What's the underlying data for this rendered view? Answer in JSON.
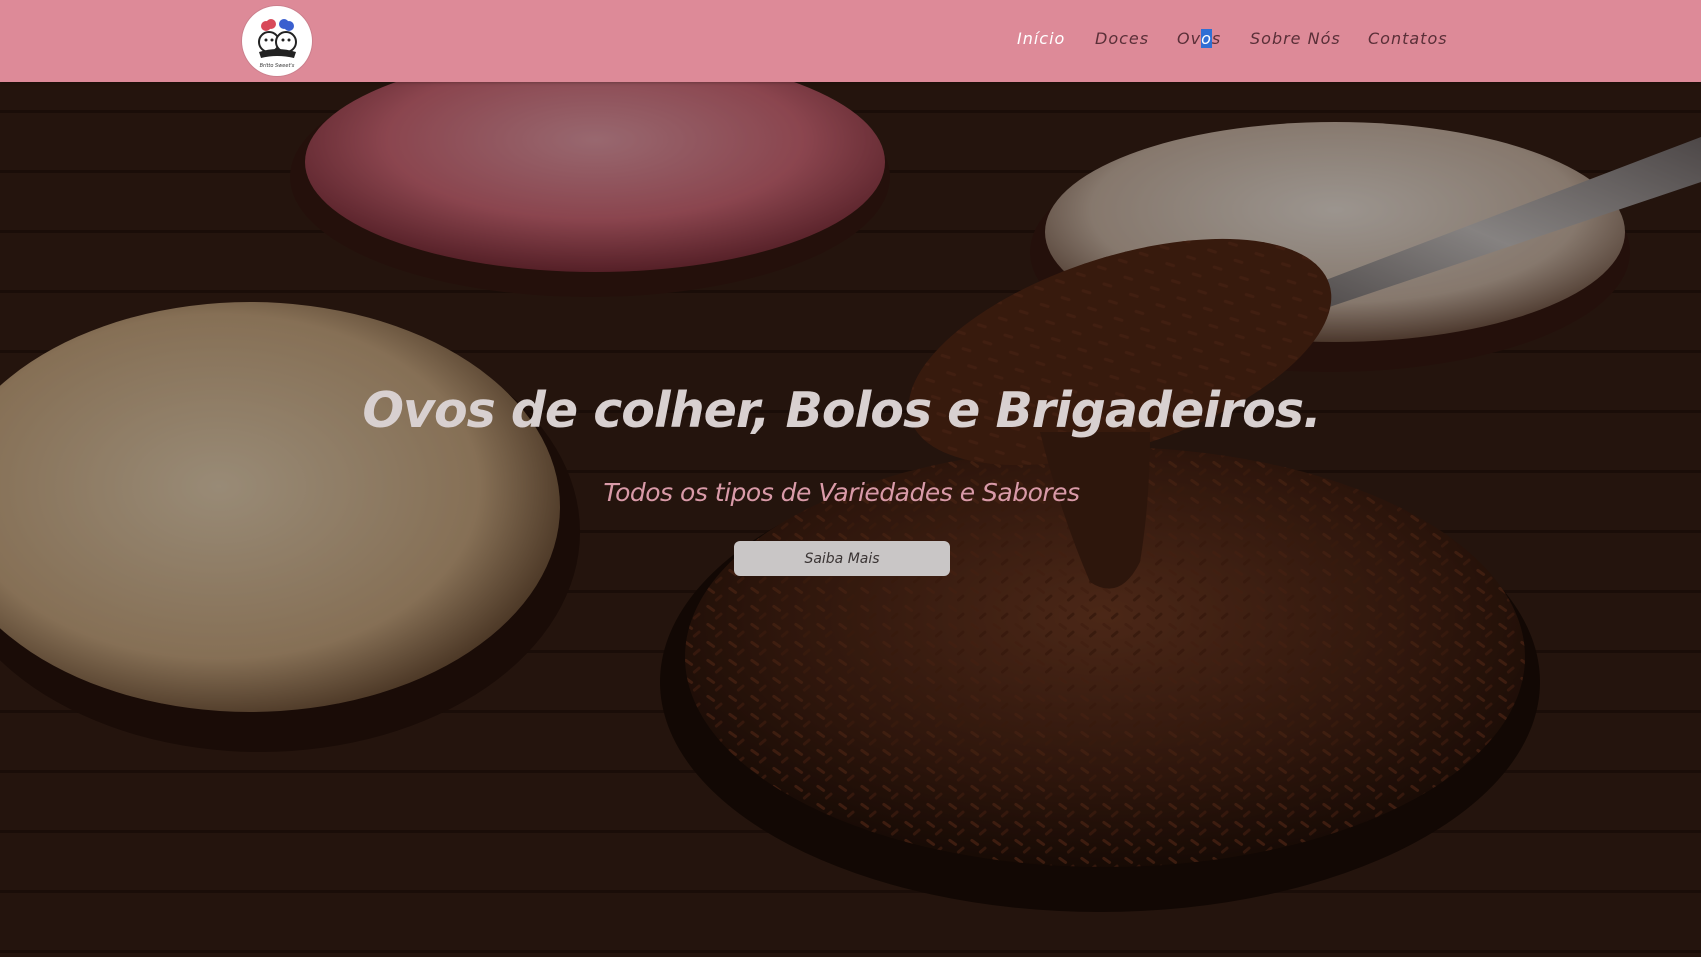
{
  "brand": {
    "logo_text": "Britto Sweet's",
    "logo_icon": "two-chefs-logo-icon"
  },
  "nav": {
    "items": [
      {
        "label": "Início",
        "active": true
      },
      {
        "label": "Doces",
        "active": false
      },
      {
        "label_parts": [
          "Ov",
          "o",
          "s"
        ],
        "active": false
      },
      {
        "label": "Sobre Nós",
        "active": false
      },
      {
        "label": "Contatos",
        "active": false
      }
    ]
  },
  "hero": {
    "title": "Ovos de colher, Bolos e Brigadeiros.",
    "subtitle": "Todos os tipos de Variedades e Sabores",
    "button_label": "Saiba Mais",
    "image": "chocolate-eggs-with-sprinkles-photo"
  },
  "colors": {
    "navbar": "#dd8a98",
    "nav_active": "#ffffff",
    "nav_text": "#5a2f38",
    "subtitle": "#d99aa8",
    "button_bg": "#c9c6c6"
  }
}
